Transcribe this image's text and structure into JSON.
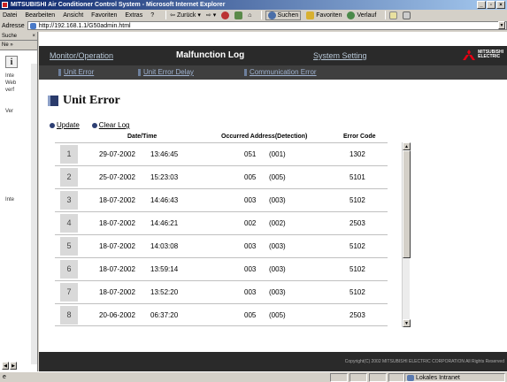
{
  "window": {
    "title": "MITSUBISHI Air Conditioner Control System - Microsoft Internet Explorer",
    "minimize_glyph": "_",
    "maximize_glyph": "▫",
    "close_glyph": "×"
  },
  "menubar": {
    "items": [
      "Datei",
      "Bearbeiten",
      "Ansicht",
      "Favoriten",
      "Extras",
      "?"
    ],
    "back": "Zurück",
    "search": "Suchen",
    "favorites": "Favoriten",
    "history": "Verlauf"
  },
  "address": {
    "label": "Adresse",
    "url": "http://192.168.1.1/G50admin.html"
  },
  "sidepanel": {
    "title": "Suche",
    "close": "×",
    "toolbar": "Ne »",
    "info_glyph": "i",
    "lines": [
      "Inte",
      "Web",
      "verf",
      "Ver",
      "Inte"
    ]
  },
  "nav": {
    "monitor": "Monitor/Operation",
    "title": "Malfunction Log",
    "system": "System Setting",
    "logo_line1": "MITSUBISHI",
    "logo_line2": "ELECTRIC"
  },
  "subnav": {
    "unit_error": "Unit Error",
    "unit_error_delay": "Unit Error Delay",
    "communication_error": "Communication Error"
  },
  "page": {
    "heading": "Unit Error",
    "update": "Update",
    "clear_log": "Clear Log"
  },
  "table": {
    "headers": {
      "datetime": "Date/Time",
      "address": "Occurred Address(Detection)",
      "code": "Error Code"
    },
    "rows": [
      {
        "num": "1",
        "date": "29-07-2002",
        "time": "13:46:45",
        "address": "051",
        "detection": "(001)",
        "code": "1302"
      },
      {
        "num": "2",
        "date": "25-07-2002",
        "time": "15:23:03",
        "address": "005",
        "detection": "(005)",
        "code": "5101"
      },
      {
        "num": "3",
        "date": "18-07-2002",
        "time": "14:46:43",
        "address": "003",
        "detection": "(003)",
        "code": "5102"
      },
      {
        "num": "4",
        "date": "18-07-2002",
        "time": "14:46:21",
        "address": "002",
        "detection": "(002)",
        "code": "2503"
      },
      {
        "num": "5",
        "date": "18-07-2002",
        "time": "14:03:08",
        "address": "003",
        "detection": "(003)",
        "code": "5102"
      },
      {
        "num": "6",
        "date": "18-07-2002",
        "time": "13:59:14",
        "address": "003",
        "detection": "(003)",
        "code": "5102"
      },
      {
        "num": "7",
        "date": "18-07-2002",
        "time": "13:52:20",
        "address": "003",
        "detection": "(003)",
        "code": "5102"
      },
      {
        "num": "8",
        "date": "20-06-2002",
        "time": "06:37:20",
        "address": "005",
        "detection": "(005)",
        "code": "2503"
      }
    ]
  },
  "footer": {
    "copyright": "Copyright(C) 2002 MITSUBISHI ELECTRIC CORPORATION All Rights Reserved"
  },
  "status": {
    "zone": "Lokales Intranet"
  },
  "colors": {
    "nav_bg": "#2a2a2a",
    "subnav_bg": "#3f3f3f",
    "accent": "#2d3f73",
    "logo_red": "#e60012"
  }
}
